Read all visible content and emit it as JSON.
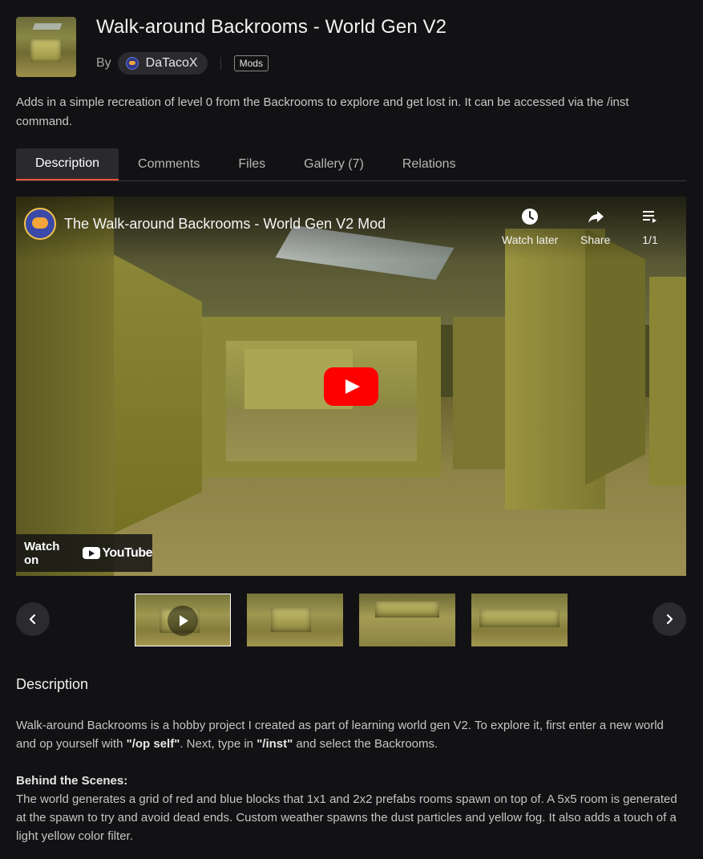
{
  "project": {
    "title": "Walk-around Backrooms - World Gen V2",
    "by_label": "By",
    "author": "DaTacoX",
    "tag": "Mods",
    "summary": "Adds in a simple recreation of level 0 from the Backrooms to explore and get lost in. It can be accessed via the /inst command."
  },
  "tabs": [
    {
      "label": "Description",
      "active": true
    },
    {
      "label": "Comments",
      "active": false
    },
    {
      "label": "Files",
      "active": false
    },
    {
      "label": "Gallery (7)",
      "active": false
    },
    {
      "label": "Relations",
      "active": false
    }
  ],
  "video": {
    "title": "The Walk-around Backrooms - World Gen V2 Mod",
    "watch_later": "Watch later",
    "share": "Share",
    "playlist": "1/1",
    "watch_on": "Watch on",
    "youtube": "YouTube"
  },
  "gallery": {
    "prev_icon": "chevron-left-icon",
    "next_icon": "chevron-right-icon",
    "selected_index": 0
  },
  "description": {
    "heading": "Description",
    "p1_a": "Walk-around Backrooms is a hobby project I created as part of learning world gen V2. To explore it, first enter a new world and op yourself with ",
    "p1_b": "\"/op self\"",
    "p1_c": ". Next, type in ",
    "p1_d": "\"/inst\"",
    "p1_e": " and select the Backrooms.",
    "behind_heading": "Behind the Scenes:",
    "p2": "The world generates a grid of red and blue blocks that 1x1 and 2x2 prefabs rooms spawn on top of. A 5x5 room is generated at the spawn to try and avoid dead ends. Custom weather spawns the dust particles and yellow fog. It also adds a touch of a light yellow color filter."
  },
  "colors": {
    "background": "#121113",
    "accent": "#e6543a",
    "youtube_red": "#ff0000"
  }
}
